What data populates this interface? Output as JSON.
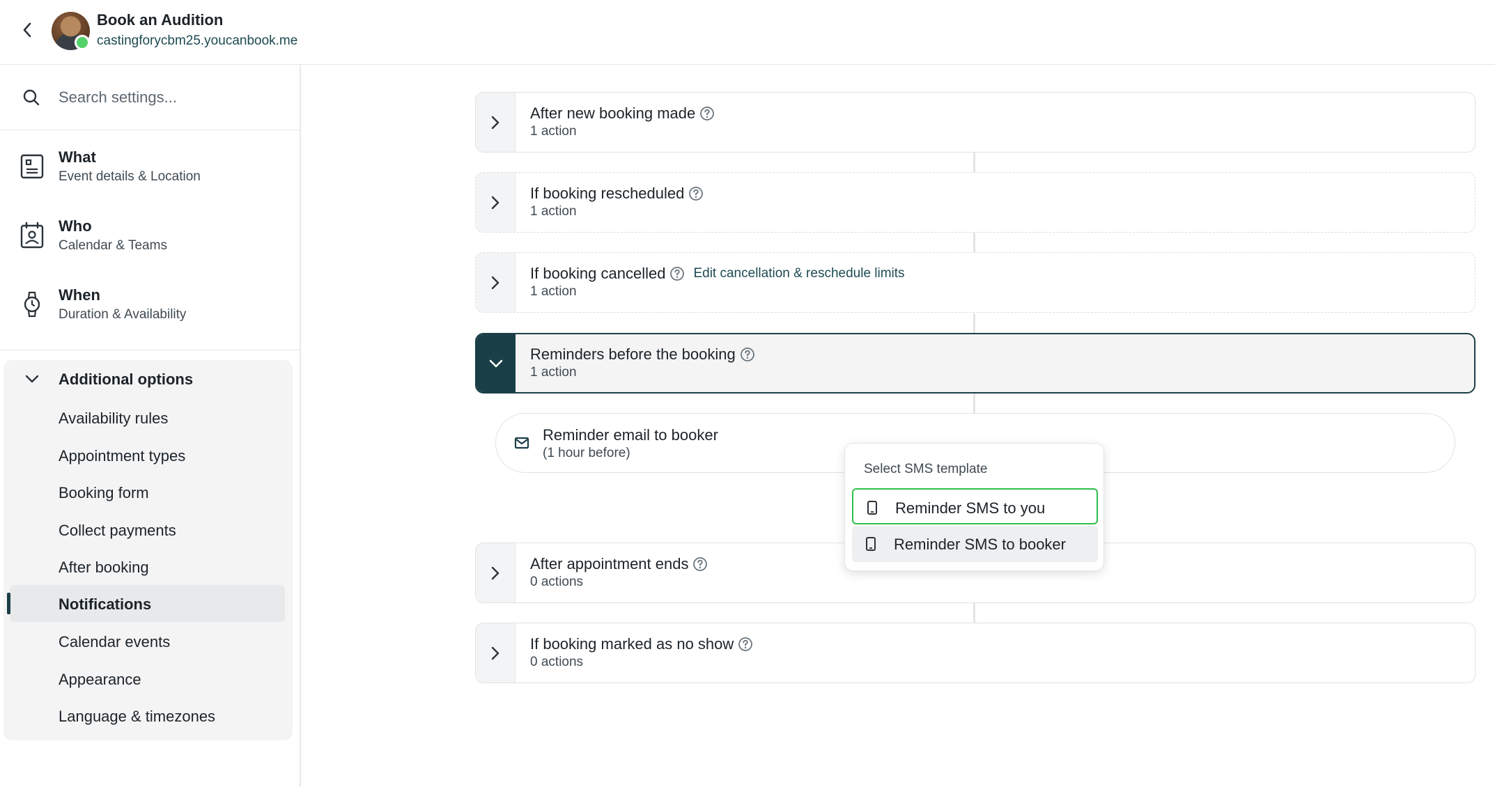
{
  "header": {
    "title": "Book an Audition",
    "url": "castingforycbm25.youcanbook.me"
  },
  "sidebar": {
    "search_placeholder": "Search settings...",
    "main_items": [
      {
        "title": "What",
        "subtitle": "Event details & Location"
      },
      {
        "title": "Who",
        "subtitle": "Calendar & Teams"
      },
      {
        "title": "When",
        "subtitle": "Duration & Availability"
      }
    ],
    "additional_label": "Additional options",
    "sub_items": [
      {
        "label": "Availability rules"
      },
      {
        "label": "Appointment types"
      },
      {
        "label": "Booking form"
      },
      {
        "label": "Collect payments"
      },
      {
        "label": "After booking"
      },
      {
        "label": "Notifications",
        "active": true
      },
      {
        "label": "Calendar events"
      },
      {
        "label": "Appearance"
      },
      {
        "label": "Language & timezones"
      }
    ]
  },
  "sections": [
    {
      "title": "After new booking made",
      "count": "1 action"
    },
    {
      "title": "If booking rescheduled",
      "count": "1 action"
    },
    {
      "title": "If booking cancelled",
      "count": "1 action",
      "link": "Edit cancellation & reschedule limits"
    },
    {
      "title": "Reminders before the booking",
      "count": "1 action",
      "expanded": true
    },
    {
      "title": "After appointment ends",
      "count": "0 actions"
    },
    {
      "title": "If booking marked as no show",
      "count": "0 actions"
    }
  ],
  "reminder_action": {
    "title": "Reminder email to booker",
    "subtitle": "(1 hour before)"
  },
  "sms_dropdown": {
    "label": "Select SMS template",
    "options": [
      {
        "label": "Reminder SMS to you",
        "state": "focused"
      },
      {
        "label": "Reminder SMS to booker",
        "state": "hover"
      }
    ]
  },
  "colors": {
    "accent": "#1b3f47",
    "link": "#1d4a52",
    "focus": "#2fbf4a",
    "online": "#55d16a"
  }
}
